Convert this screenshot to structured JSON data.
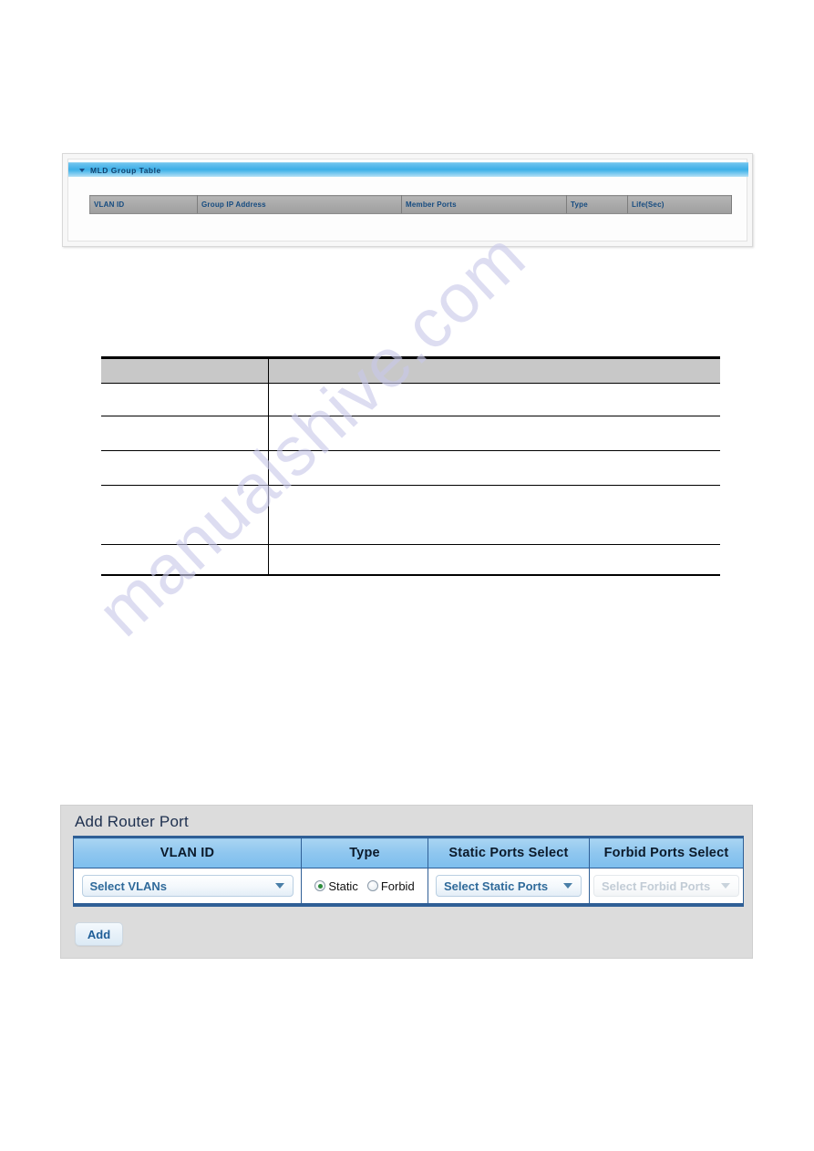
{
  "watermark": {
    "text": "manualshive.com"
  },
  "mld_panel": {
    "title": "MLD Group Table",
    "collapse_icon": "triangle-down-icon",
    "table": {
      "columns": [
        "VLAN ID",
        "Group IP Address",
        "Member Ports",
        "Type",
        "Life(Sec)"
      ],
      "rows": []
    }
  },
  "description_table": {
    "columns": [
      "",
      ""
    ],
    "rows": [
      {
        "c1": "",
        "c2": ""
      },
      {
        "c1": "",
        "c2": ""
      },
      {
        "c1": "",
        "c2": ""
      },
      {
        "c1": "",
        "c2": ""
      },
      {
        "c1": "",
        "c2": ""
      }
    ]
  },
  "add_router_port": {
    "title": "Add Router Port",
    "columns": [
      "VLAN ID",
      "Type",
      "Static Ports Select",
      "Forbid Ports Select"
    ],
    "vlan_select": {
      "value": "Select VLANs",
      "caret_icon": "chevron-down-icon"
    },
    "type": {
      "options": [
        "Static",
        "Forbid"
      ],
      "selected": "Static"
    },
    "static_ports_select": {
      "value": "Select Static Ports",
      "caret_icon": "chevron-down-icon",
      "disabled": false
    },
    "forbid_ports_select": {
      "value": "Select Forbid Ports",
      "caret_icon": "chevron-down-icon",
      "disabled": true
    },
    "add_button": "Add"
  },
  "colors": {
    "panel_header_blue": "#3fb0e8",
    "table_header_gray": "#a9a9a9",
    "header_text_blue": "#154b80",
    "arp_header_blue": "#8ec6ef",
    "arp_border_blue": "#2f5f96",
    "radio_selected_green": "#2c8c3b",
    "watermark_purple": "#c9c9ea"
  }
}
